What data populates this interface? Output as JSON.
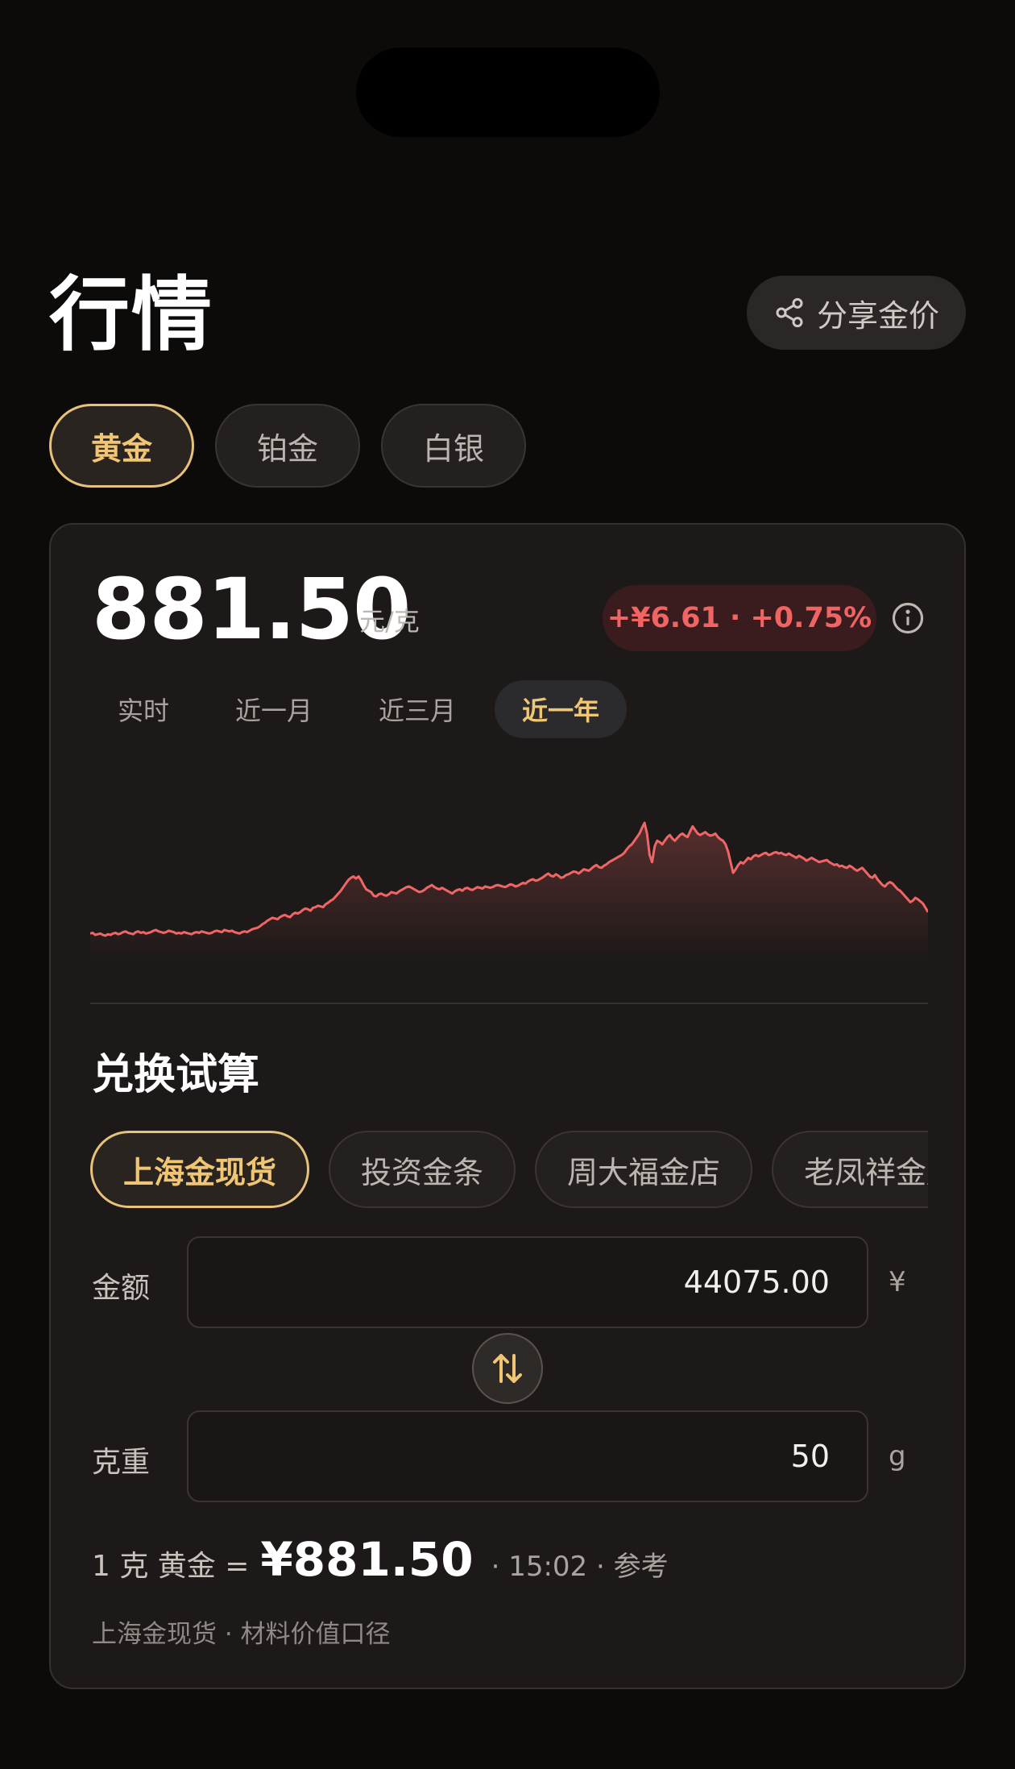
{
  "page": {
    "title": "行情",
    "share_label": "分享金价"
  },
  "metal_tabs": [
    {
      "label": "黄金",
      "active": true
    },
    {
      "label": "铂金",
      "active": false
    },
    {
      "label": "白银",
      "active": false
    }
  ],
  "quote": {
    "price": "881.50",
    "unit": "元/克",
    "change": "+¥6.61 · +0.75%"
  },
  "range_tabs": [
    {
      "label": "实时",
      "active": false
    },
    {
      "label": "近一月",
      "active": false
    },
    {
      "label": "近三月",
      "active": false
    },
    {
      "label": "近一年",
      "active": true
    }
  ],
  "chart_data": {
    "type": "area",
    "line_color": "#f06666",
    "values": [
      20,
      21,
      18,
      19,
      20,
      18,
      17,
      19,
      18,
      20,
      21,
      19,
      20,
      22,
      23,
      21,
      20,
      19,
      22,
      23,
      21,
      22,
      20,
      21,
      22,
      24,
      25,
      23,
      22,
      21,
      22,
      24,
      23,
      22,
      20,
      21,
      20,
      22,
      21,
      20,
      19,
      21,
      22,
      21,
      23,
      22,
      21,
      20,
      21,
      23,
      24,
      23,
      22,
      25,
      24,
      23,
      24,
      22,
      21,
      20,
      22,
      23,
      22,
      24,
      26,
      27,
      28,
      30,
      33,
      35,
      38,
      40,
      42,
      41,
      40,
      43,
      45,
      46,
      44,
      43,
      47,
      49,
      48,
      50,
      53,
      55,
      54,
      52,
      56,
      57,
      59,
      58,
      57,
      61,
      63,
      66,
      68,
      72,
      76,
      80,
      85,
      90,
      95,
      98,
      100,
      97,
      100,
      95,
      88,
      82,
      80,
      78,
      73,
      72,
      75,
      76,
      74,
      73,
      75,
      78,
      77,
      76,
      79,
      81,
      83,
      85,
      86,
      84,
      82,
      80,
      78,
      79,
      81,
      84,
      86,
      88,
      85,
      83,
      82,
      84,
      82,
      80,
      78,
      76,
      79,
      81,
      82,
      80,
      83,
      84,
      82,
      81,
      83,
      85,
      84,
      83,
      86,
      85,
      84,
      85,
      87,
      88,
      87,
      86,
      85,
      87,
      89,
      88,
      86,
      87,
      89,
      91,
      90,
      93,
      95,
      96,
      94,
      95,
      97,
      99,
      102,
      104,
      101,
      100,
      103,
      101,
      98,
      99,
      102,
      103,
      105,
      107,
      106,
      104,
      107,
      110,
      109,
      108,
      111,
      114,
      116,
      113,
      112,
      115,
      117,
      120,
      122,
      124,
      126,
      128,
      130,
      133,
      138,
      142,
      145,
      150,
      155,
      160,
      168,
      175,
      160,
      130,
      120,
      142,
      150,
      148,
      145,
      150,
      155,
      158,
      153,
      150,
      154,
      158,
      160,
      157,
      155,
      163,
      170,
      165,
      160,
      158,
      160,
      162,
      159,
      157,
      158,
      160,
      155,
      152,
      150,
      145,
      135,
      120,
      105,
      110,
      116,
      120,
      118,
      122,
      126,
      124,
      128,
      130,
      128,
      130,
      132,
      133,
      130,
      131,
      133,
      134,
      132,
      133,
      131,
      130,
      132,
      130,
      128,
      126,
      129,
      127,
      125,
      122,
      124,
      126,
      124,
      122,
      120,
      121,
      122,
      123,
      120,
      118,
      116,
      117,
      114,
      115,
      113,
      112,
      115,
      113,
      110,
      108,
      110,
      112,
      108,
      104,
      100,
      98,
      102,
      96,
      92,
      88,
      86,
      90,
      92,
      90,
      86,
      82,
      80,
      76,
      72,
      68,
      64,
      66,
      70,
      68,
      65,
      62,
      56,
      50
    ]
  },
  "calc": {
    "title": "兑换试算",
    "sources": [
      {
        "label": "上海金现货",
        "active": true
      },
      {
        "label": "投资金条",
        "active": false
      },
      {
        "label": "周大福金店",
        "active": false
      },
      {
        "label": "老凤祥金店",
        "active": false
      }
    ],
    "amount_label": "金额",
    "amount_value": "44075.00",
    "amount_unit": "¥",
    "weight_label": "克重",
    "weight_value": "50",
    "weight_unit": "g",
    "rate_prefix": "1 克 黄金 =",
    "rate_value": "¥881.50",
    "rate_meta": "· 15:02 · 参考",
    "footnote": "上海金现货 · 材料价值口径"
  },
  "colors": {
    "accent_gold": "#f0c674",
    "up_red": "#f06464",
    "background": "#0c0b0a",
    "card": "#1c1918"
  }
}
